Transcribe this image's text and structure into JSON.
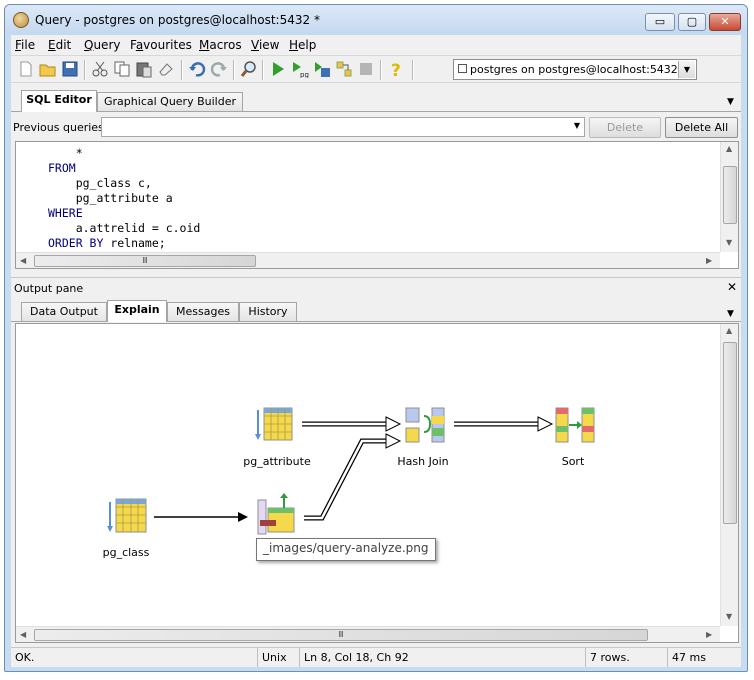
{
  "window": {
    "title": "Query - postgres on postgres@localhost:5432 *",
    "buttons": {
      "minimize": "▭",
      "maximize": "▢",
      "close": "✕"
    }
  },
  "menu": [
    "File",
    "Edit",
    "Query",
    "Favourites",
    "Macros",
    "View",
    "Help"
  ],
  "menu_underline": [
    "F",
    "E",
    "Q",
    "a",
    "M",
    "V",
    "H"
  ],
  "toolbar": {
    "icons": [
      "new-icon",
      "open-icon",
      "save-icon",
      "cut-icon",
      "copy-icon",
      "paste-icon",
      "clear-icon",
      "undo-icon",
      "redo-icon",
      "find-icon",
      "execute-icon",
      "execute-pgscript-icon",
      "execute-to-file-icon",
      "explain-icon",
      "cancel-icon",
      "help-icon"
    ],
    "server": "postgres on postgres@localhost:5432"
  },
  "editor_tabs": [
    "SQL Editor",
    "Graphical Query Builder"
  ],
  "previous_queries": {
    "label": "Previous queries",
    "value": ""
  },
  "buttons": {
    "delete": "Delete",
    "delete_all": "Delete All"
  },
  "sql_lines": [
    {
      "kw": "",
      "text": "    *"
    },
    {
      "kw": "FROM",
      "text": ""
    },
    {
      "kw": "",
      "text": "    pg_class c,"
    },
    {
      "kw": "",
      "text": "    pg_attribute a"
    },
    {
      "kw": "WHERE",
      "text": ""
    },
    {
      "kw": "",
      "text": "    a.attrelid = c.oid"
    },
    {
      "kw": "ORDER BY",
      "text": " relname;"
    }
  ],
  "output": {
    "title": "Output pane",
    "close": "✕",
    "tabs": [
      "Data Output",
      "Explain",
      "Messages",
      "History"
    ]
  },
  "plan": {
    "nodes": [
      "pg_attribute",
      "pg_class",
      "Hash Join",
      "Sort"
    ],
    "hash_label_partial": "H",
    "tooltip": "_images/query-analyze.png"
  },
  "status": {
    "message": "OK.",
    "encoding": "Unix",
    "position": "Ln 8, Col 18, Ch 92",
    "rows": "7 rows.",
    "time": "47 ms"
  },
  "scroll_grip": "Ⅲ"
}
